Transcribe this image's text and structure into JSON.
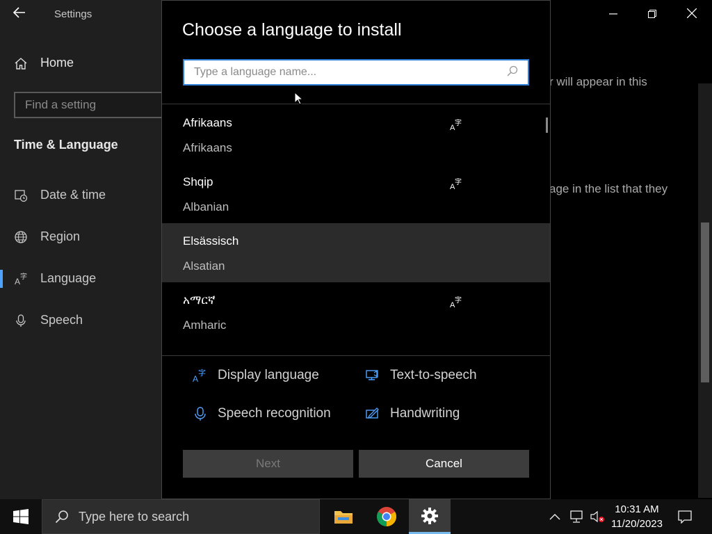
{
  "settings": {
    "app_title": "Settings",
    "home_label": "Home",
    "find_placeholder": "Find a setting",
    "section_title": "Time & Language",
    "nav": [
      {
        "label": "Date & time",
        "icon": "calendar-clock-icon"
      },
      {
        "label": "Region",
        "icon": "globe-icon"
      },
      {
        "label": "Language",
        "icon": "language-icon"
      },
      {
        "label": "Speech",
        "icon": "microphone-icon"
      }
    ],
    "bg_text_1": "r will appear in this",
    "bg_text_2": "age in the list that they"
  },
  "dialog": {
    "title": "Choose a language to install",
    "search_placeholder": "Type a language name...",
    "languages": [
      {
        "native": "Afrikaans",
        "english": "Afrikaans",
        "display_language": true
      },
      {
        "native": "Shqip",
        "english": "Albanian",
        "display_language": true
      },
      {
        "native": "Elsässisch",
        "english": "Alsatian",
        "display_language": false
      },
      {
        "native": "አማርኛ",
        "english": "Amharic",
        "display_language": true
      }
    ],
    "legend": {
      "display_language": "Display language",
      "text_to_speech": "Text-to-speech",
      "speech_recognition": "Speech recognition",
      "handwriting": "Handwriting"
    },
    "next_label": "Next",
    "cancel_label": "Cancel"
  },
  "taskbar": {
    "search_placeholder": "Type here to search",
    "time": "10:31 AM",
    "date": "11/20/2023"
  },
  "colors": {
    "accent": "#4fa3ff",
    "search_border": "#2f7fd6",
    "button_bg": "#3d3d3d"
  }
}
